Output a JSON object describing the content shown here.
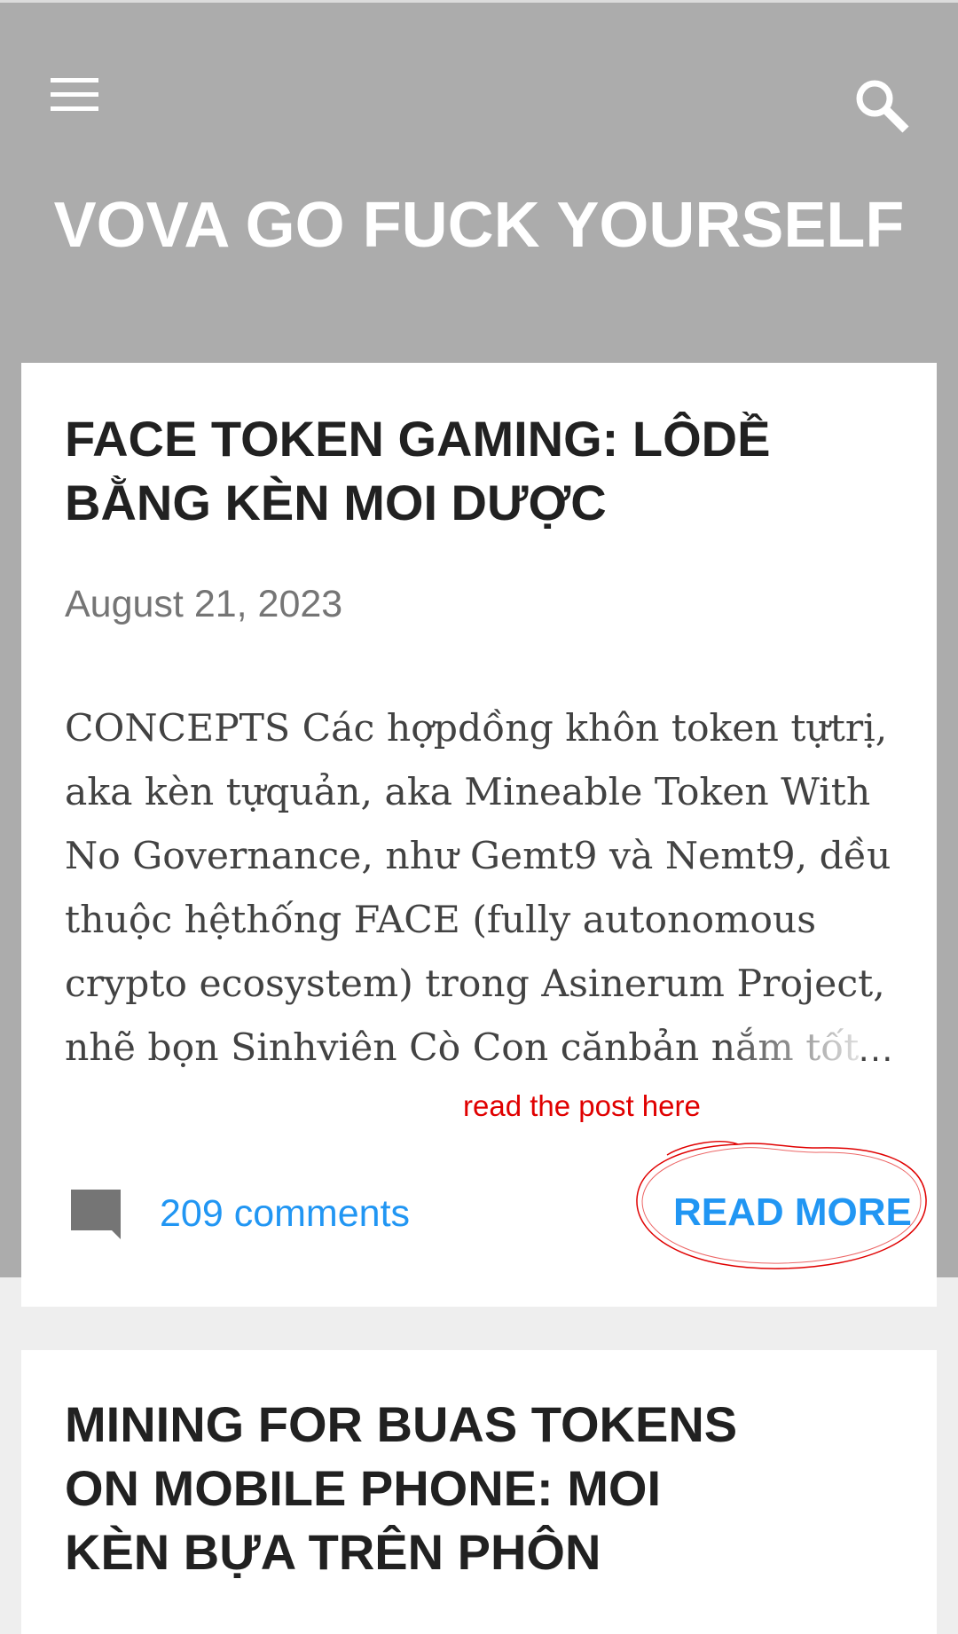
{
  "header": {
    "menu_icon": "hamburger-menu-icon",
    "search_icon": "search-icon",
    "site_title": "VOVA GO FUCK YOURSELF",
    "background_color": "#acacac"
  },
  "posts": [
    {
      "title_lines": [
        "FACE TOKEN GAMING: LÔDỀ",
        "BẰNG KÈN MOI DƯỢC"
      ],
      "date": "August 21, 2023",
      "snippet_lines": [
        "CONCEPTS Các hợpdồng khôn token tựtrị,",
        "aka kèn tựquản, aka Mineable Token With",
        "No Governance, như Gemt9 và Nemt9, dều",
        "thuộc hệthống FACE (fully autonomous",
        "crypto ecosystem) trong Asinerum Project,",
        "nhẽ bọn Sinhviên Cò Con cănbản nắm tốt"
      ],
      "ellipsis": "…",
      "annotation": "read the post here",
      "comment_icon": "comment-icon",
      "comments_label": "209 comments",
      "read_more_label": "READ MORE"
    },
    {
      "title_lines": [
        "MINING FOR BUAS TOKENS",
        "ON MOBILE PHONE: MOI",
        "KÈN BỰA TRÊN PHÔN"
      ]
    }
  ],
  "colors": {
    "accent": "#2196f3",
    "annotation": "#e00000",
    "title_text": "#212121"
  }
}
